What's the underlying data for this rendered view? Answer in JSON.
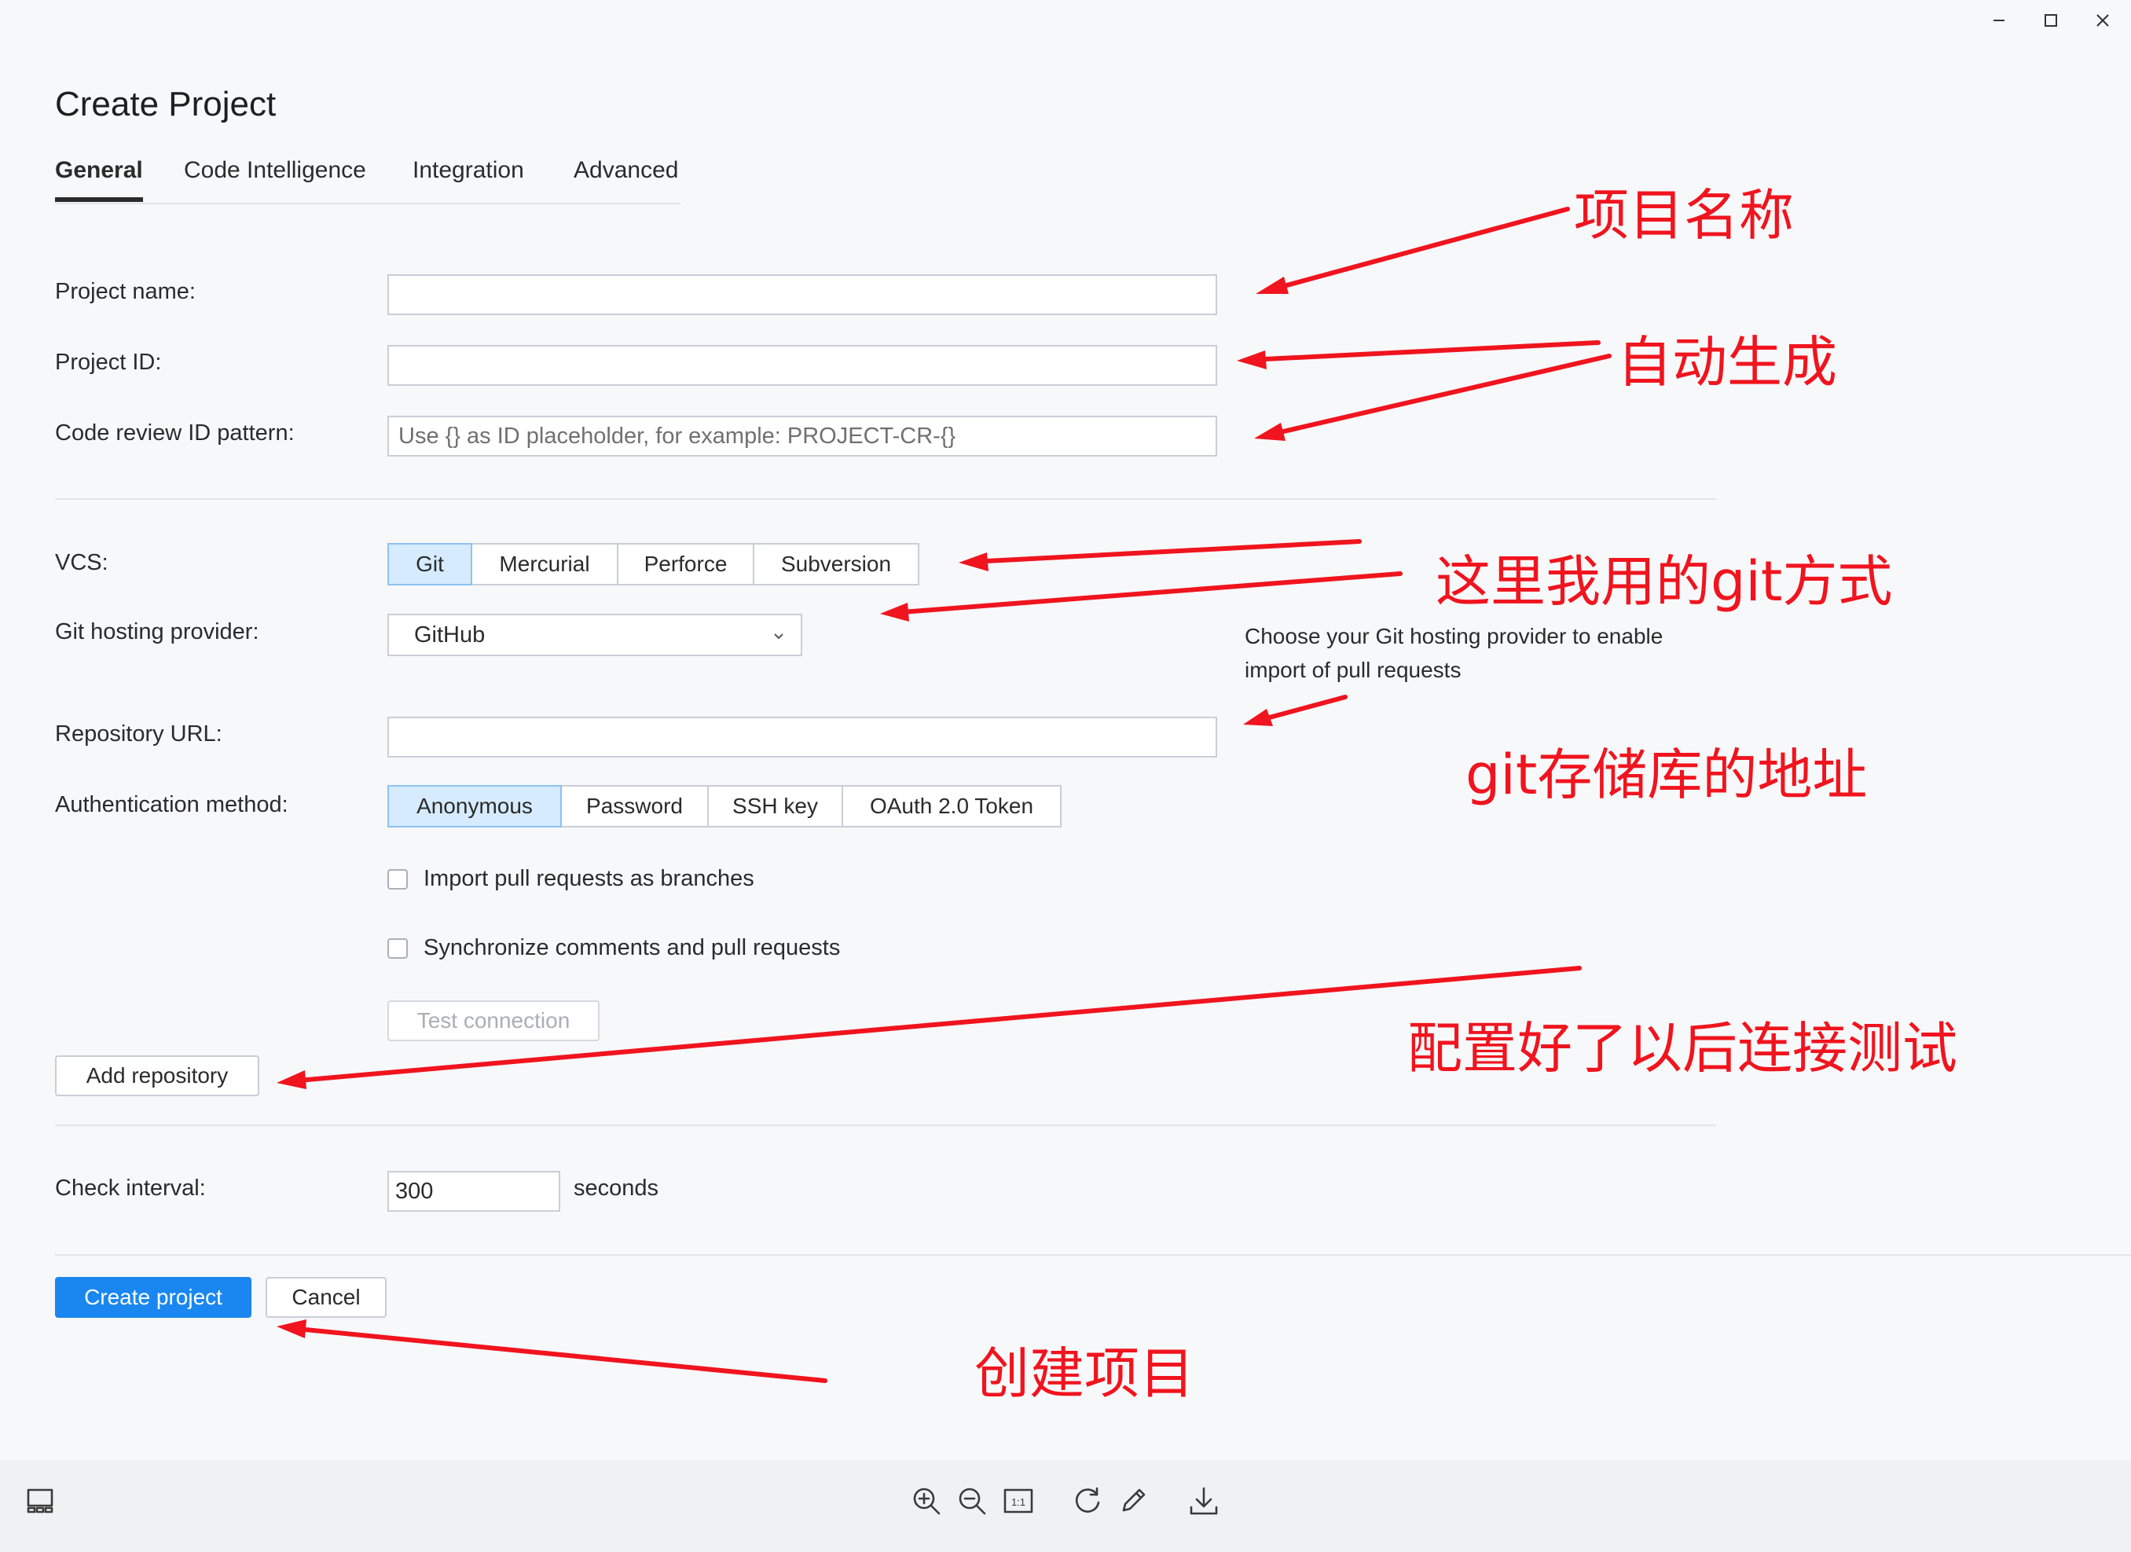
{
  "window": {
    "minimize_icon": "minimize-icon",
    "maximize_icon": "maximize-icon",
    "close_icon": "close-icon"
  },
  "page_title": "Create Project",
  "tabs": [
    {
      "label": "General",
      "active": true
    },
    {
      "label": "Code Intelligence",
      "active": false
    },
    {
      "label": "Integration",
      "active": false
    },
    {
      "label": "Advanced",
      "active": false
    }
  ],
  "form": {
    "project_name": {
      "label": "Project name:",
      "value": ""
    },
    "project_id": {
      "label": "Project ID:",
      "value": ""
    },
    "code_review_pattern": {
      "label": "Code review ID pattern:",
      "value": "",
      "placeholder": "Use {} as ID placeholder, for example: PROJECT-CR-{}"
    },
    "vcs": {
      "label": "VCS:",
      "options": [
        "Git",
        "Mercurial",
        "Perforce",
        "Subversion"
      ],
      "selected": "Git"
    },
    "git_hosting": {
      "label": "Git hosting provider:",
      "value": "GitHub",
      "hint_line1": "Choose your Git hosting provider to enable",
      "hint_line2": "import of pull requests"
    },
    "repository_url": {
      "label": "Repository URL:",
      "value": ""
    },
    "auth_method": {
      "label": "Authentication method:",
      "options": [
        "Anonymous",
        "Password",
        "SSH key",
        "OAuth 2.0 Token"
      ],
      "selected": "Anonymous"
    },
    "import_pr_branches": {
      "label": "Import pull requests as branches",
      "checked": false
    },
    "sync_comments": {
      "label": "Synchronize comments and pull requests",
      "checked": false
    },
    "test_connection_label": "Test connection",
    "add_repository_label": "Add repository",
    "check_interval": {
      "label": "Check interval:",
      "value": "300",
      "unit": "seconds"
    }
  },
  "footer": {
    "create_label": "Create project",
    "cancel_label": "Cancel"
  },
  "annotations": {
    "project_name": "项目名称",
    "auto_generate": "自动生成",
    "git_method": "这里我用的git方式",
    "repo_address": "git存储库的地址",
    "test_connection": "配置好了以后连接测试",
    "create_project": "创建项目"
  },
  "viewer_toolbar": {
    "icons": [
      "sidebar-toggle-icon",
      "zoom-in-icon",
      "zoom-out-icon",
      "actual-size-icon",
      "rotate-icon",
      "edit-icon",
      "download-icon"
    ],
    "actual_size_text": "1:1"
  },
  "colors": {
    "accent": "#1a87f0",
    "selected_bg": "#d6ebfd",
    "annotation": "#f0141e"
  }
}
